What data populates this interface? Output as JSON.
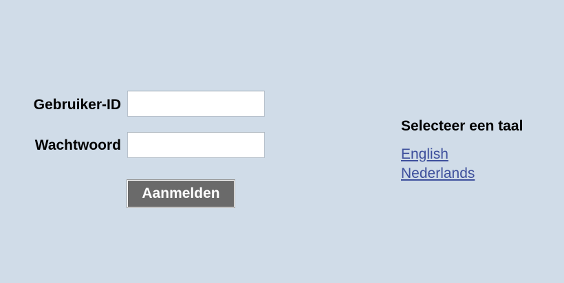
{
  "login": {
    "user_label": "Gebruiker-ID",
    "user_value": "",
    "password_label": "Wachtwoord",
    "password_value": "",
    "submit_label": "Aanmelden"
  },
  "language": {
    "heading": "Selecteer een taal",
    "options": [
      {
        "label": "English"
      },
      {
        "label": "Nederlands"
      }
    ]
  },
  "colors": {
    "background": "#d0dce8",
    "button_bg": "#6a6a6a",
    "link": "#3d4f9c"
  }
}
